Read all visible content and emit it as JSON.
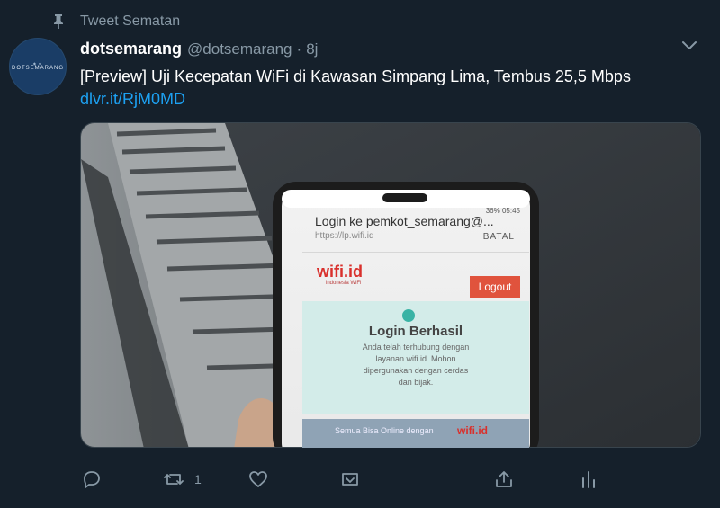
{
  "pinned": {
    "label": "Tweet Sematan"
  },
  "avatar": {
    "text": "DOTSEMARANG"
  },
  "tweet": {
    "display_name": "dotsemarang",
    "handle": "@dotsemarang",
    "separator": "·",
    "time": "8j",
    "text": "[Preview] Uji Kecepatan WiFi di Kawasan Simpang Lima, Tembus 25,5 Mbps",
    "link": "dlvr.it/RjM0MD"
  },
  "media": {
    "phone": {
      "status_time": "05:45",
      "battery": "36%",
      "login_title": "Login ke pemkot_semarang@...",
      "url": "https://lp.wifi.id",
      "cancel": "BATAL",
      "brand": "wifi.id",
      "brand_tagline": "indonesia WiFi",
      "logout": "Logout",
      "success_title": "Login Berhasil",
      "success_line1": "Anda telah terhubung dengan",
      "success_line2": "layanan wifi.id. Mohon",
      "success_line3": "dipergunakan dengan cerdas",
      "success_line4": "dan bijak.",
      "banner_text": "Semua Bisa Online dengan",
      "banner_brand": "wifi.id"
    }
  },
  "actions": {
    "retweet_count": "1"
  }
}
